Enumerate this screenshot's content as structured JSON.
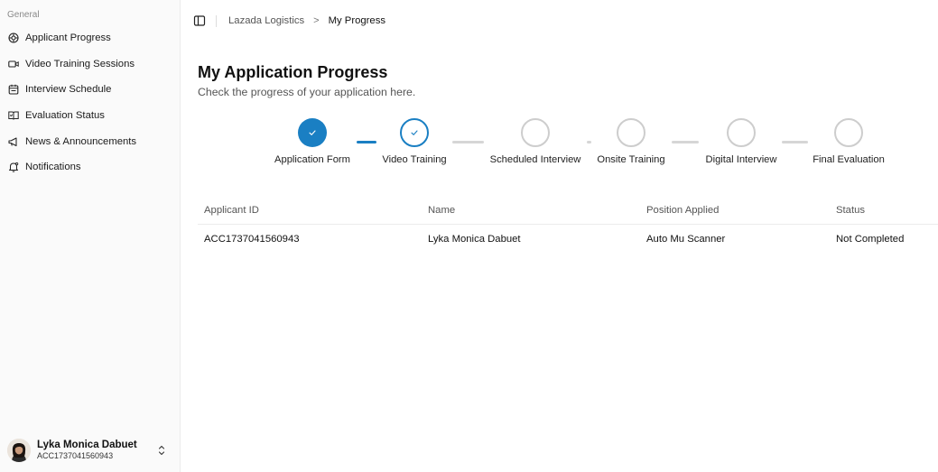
{
  "sidebar": {
    "group_label": "General",
    "items": [
      {
        "label": "Applicant Progress",
        "icon": "progress-icon"
      },
      {
        "label": "Video Training Sessions",
        "icon": "video-icon"
      },
      {
        "label": "Interview Schedule",
        "icon": "calendar-icon"
      },
      {
        "label": "Evaluation Status",
        "icon": "book-check-icon"
      },
      {
        "label": "News & Announcements",
        "icon": "megaphone-icon"
      },
      {
        "label": "Notifications",
        "icon": "bell-icon"
      }
    ],
    "user": {
      "name": "Lyka Monica Dabuet",
      "id": "ACC1737041560943"
    }
  },
  "header": {
    "breadcrumb_parent": "Lazada Logistics",
    "breadcrumb_separator": ">",
    "breadcrumb_current": "My Progress"
  },
  "main": {
    "title": "My Application Progress",
    "subtitle": "Check the progress of your application here."
  },
  "stepper": {
    "accent_color": "#1a7fc3",
    "steps": [
      {
        "label": "Application Form",
        "state": "completed"
      },
      {
        "label": "Video Training",
        "state": "current"
      },
      {
        "label": "Scheduled Interview",
        "state": "pending"
      },
      {
        "label": "Onsite Training",
        "state": "pending"
      },
      {
        "label": "Digital Interview",
        "state": "pending"
      },
      {
        "label": "Final Evaluation",
        "state": "pending"
      }
    ]
  },
  "table": {
    "columns": [
      "Applicant ID",
      "Name",
      "Position Applied",
      "Status"
    ],
    "rows": [
      [
        "ACC1737041560943",
        "Lyka Monica Dabuet",
        "Auto Mu Scanner",
        "Not Completed"
      ]
    ]
  }
}
